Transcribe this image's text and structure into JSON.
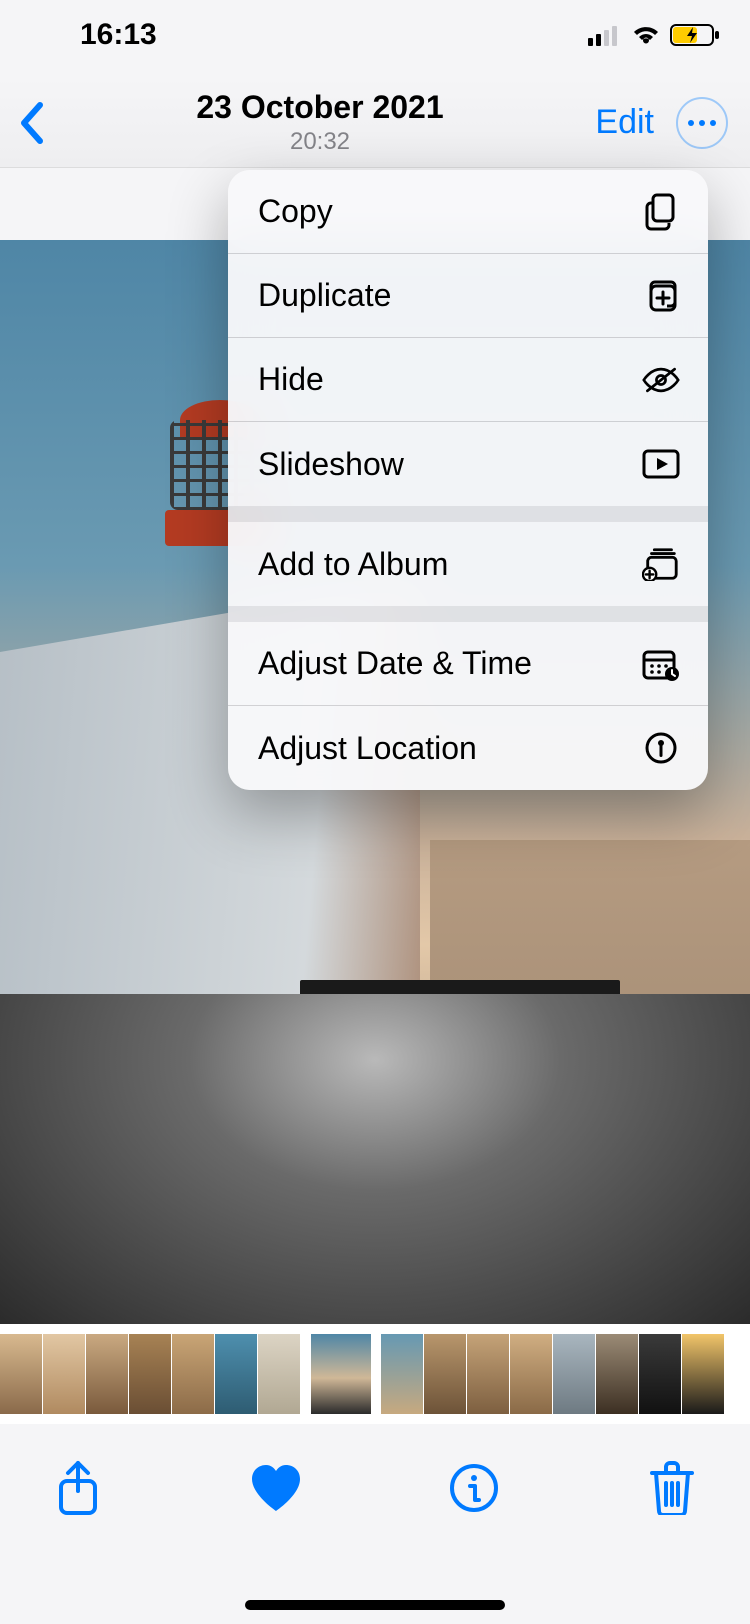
{
  "status": {
    "time": "16:13"
  },
  "nav": {
    "title": "23 October 2021",
    "subtitle": "20:32",
    "edit_label": "Edit"
  },
  "menu": {
    "groups": [
      {
        "items": [
          {
            "label": "Copy",
            "icon": "copy-icon"
          },
          {
            "label": "Duplicate",
            "icon": "duplicate-icon"
          },
          {
            "label": "Hide",
            "icon": "hide-icon"
          },
          {
            "label": "Slideshow",
            "icon": "slideshow-icon"
          }
        ]
      },
      {
        "items": [
          {
            "label": "Add to Album",
            "icon": "add-album-icon"
          }
        ]
      },
      {
        "items": [
          {
            "label": "Adjust Date & Time",
            "icon": "adjust-date-icon"
          },
          {
            "label": "Adjust Location",
            "icon": "adjust-location-icon"
          }
        ]
      }
    ]
  },
  "colors": {
    "tint": "#007aff"
  }
}
